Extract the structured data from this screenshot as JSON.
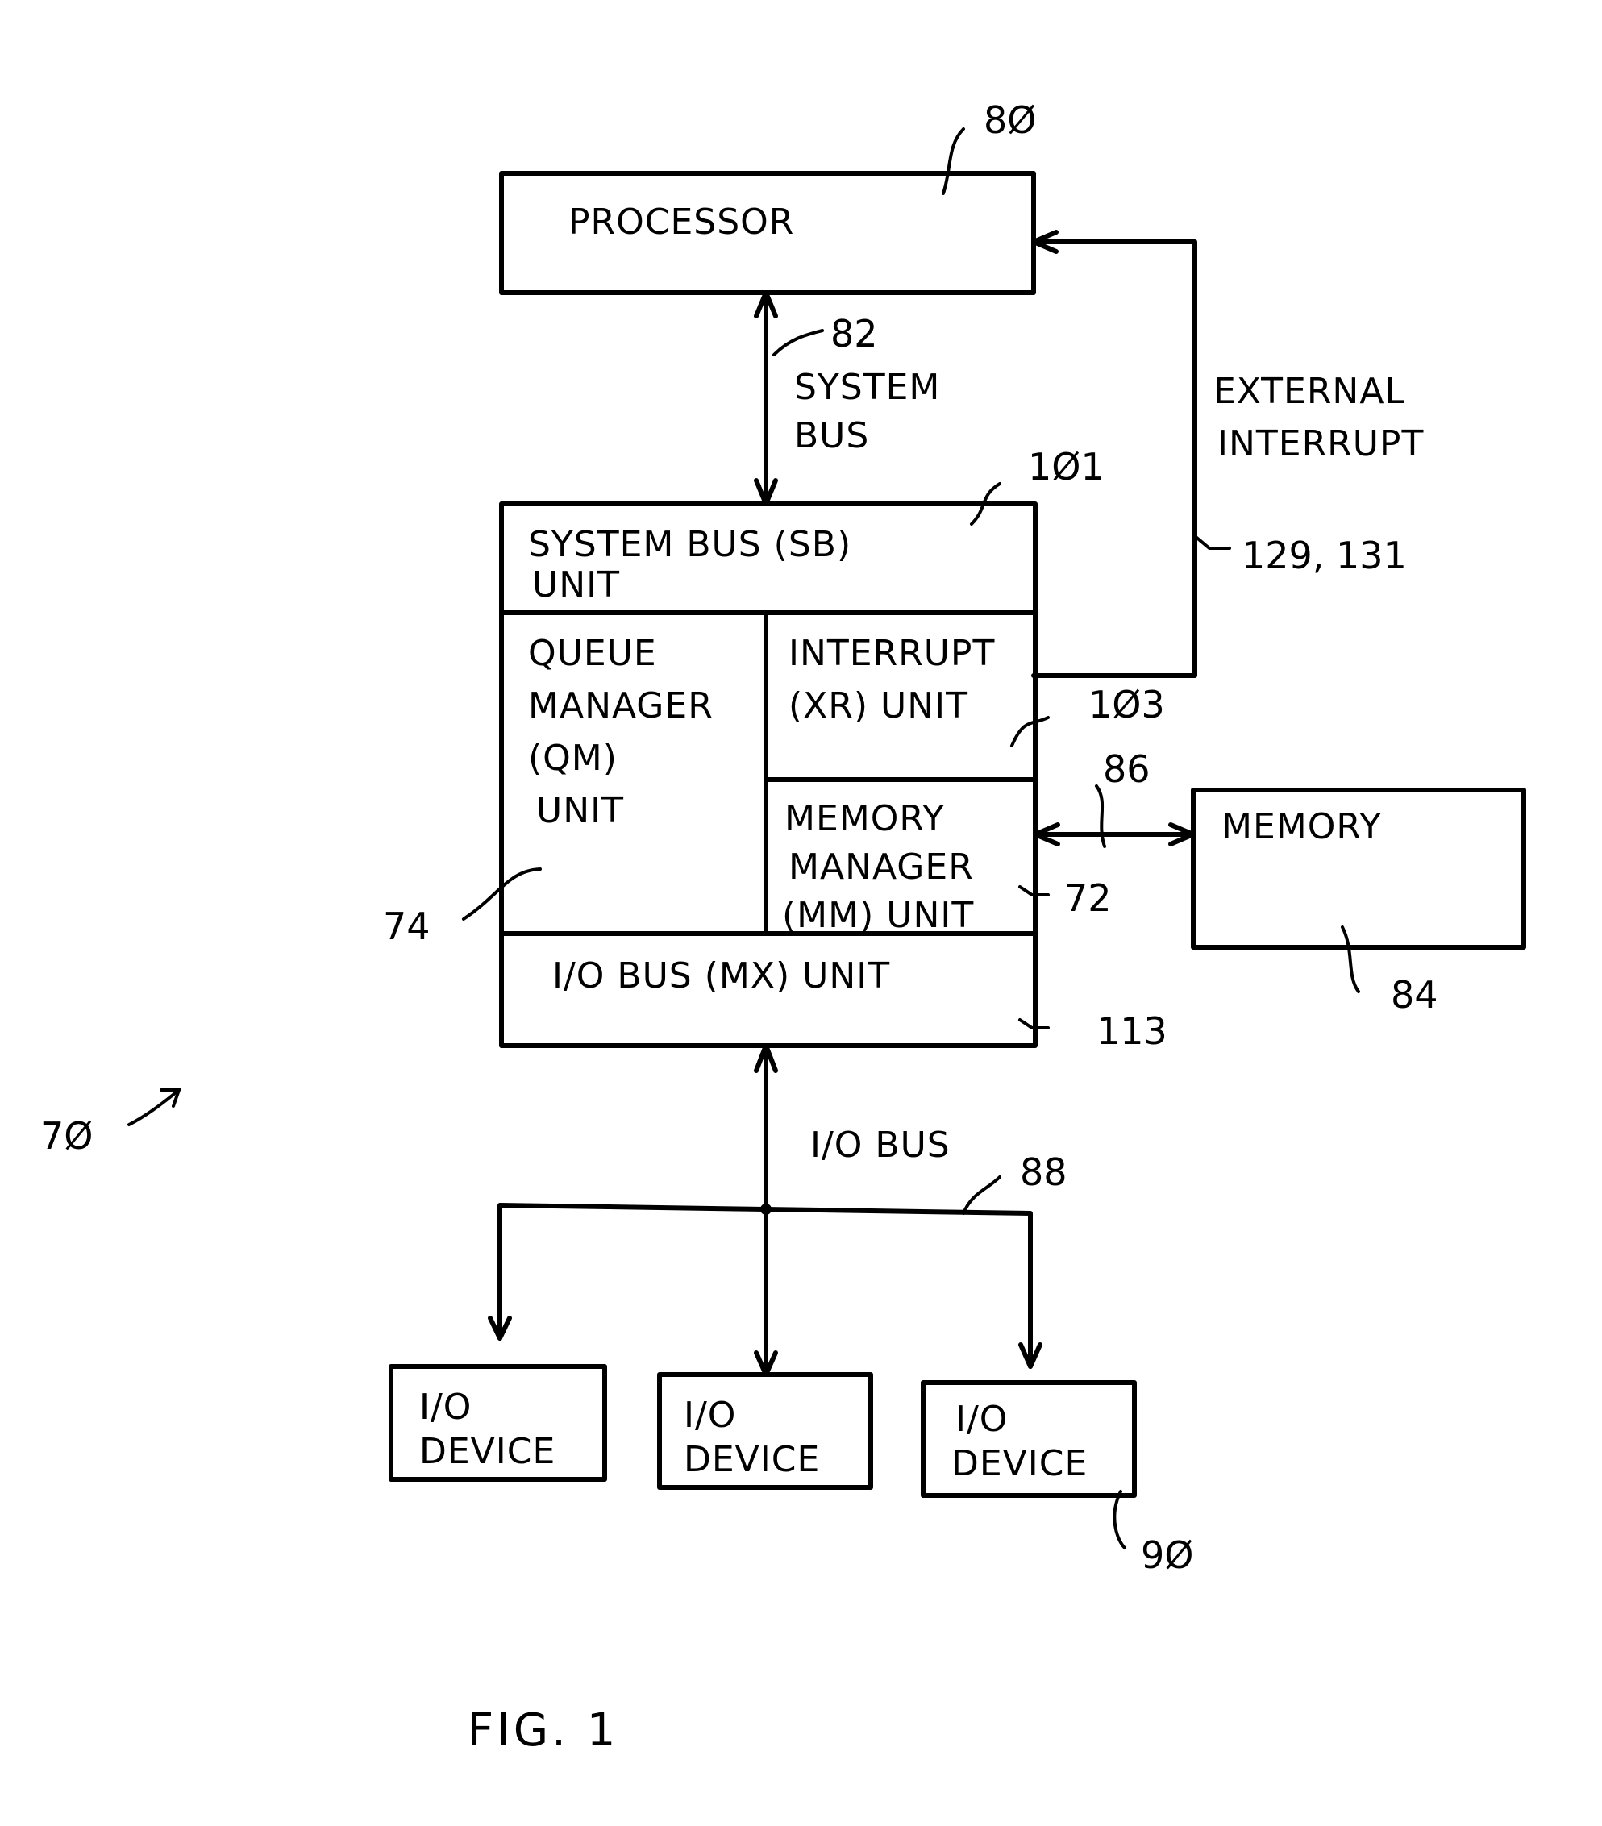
{
  "diagram": {
    "processor": {
      "label": "PROCESSOR",
      "ref": "8Ø"
    },
    "system_bus": {
      "label_line1": "SYSTEM",
      "label_line2": "BUS",
      "ref": "82"
    },
    "external_interrupt": {
      "label_line1": "EXTERNAL",
      "label_line2": "INTERRUPT",
      "ref": "129, 131"
    },
    "sb_unit": {
      "label_line1": "SYSTEM BUS (SB)",
      "label_line2": "UNIT",
      "ref": "1Ø1"
    },
    "qm_unit": {
      "lines": [
        "QUEUE",
        "MANAGER",
        "(QM)",
        "UNIT"
      ],
      "ref": "74"
    },
    "xr_unit": {
      "label_line1": "INTERRUPT",
      "label_line2": "(XR) UNIT",
      "ref": "1Ø3"
    },
    "mm_unit": {
      "lines": [
        "MEMORY",
        "MANAGER",
        "(MM) UNIT"
      ],
      "ref": "72"
    },
    "mx_unit": {
      "label": "I/O BUS (MX) UNIT",
      "ref": "113"
    },
    "memory": {
      "label": "MEMORY",
      "ref": "84"
    },
    "memory_bus": {
      "ref": "86"
    },
    "io_bus": {
      "label": "I/O BUS",
      "ref": "88"
    },
    "io_devices": [
      {
        "line1": "I/O",
        "line2": "DEVICE"
      },
      {
        "line1": "I/O",
        "line2": "DEVICE"
      },
      {
        "line1": "I/O",
        "line2": "DEVICE"
      }
    ],
    "io_device_ref": "9Ø",
    "system_ref": "7Ø",
    "figure_caption": "FIG. 1"
  }
}
